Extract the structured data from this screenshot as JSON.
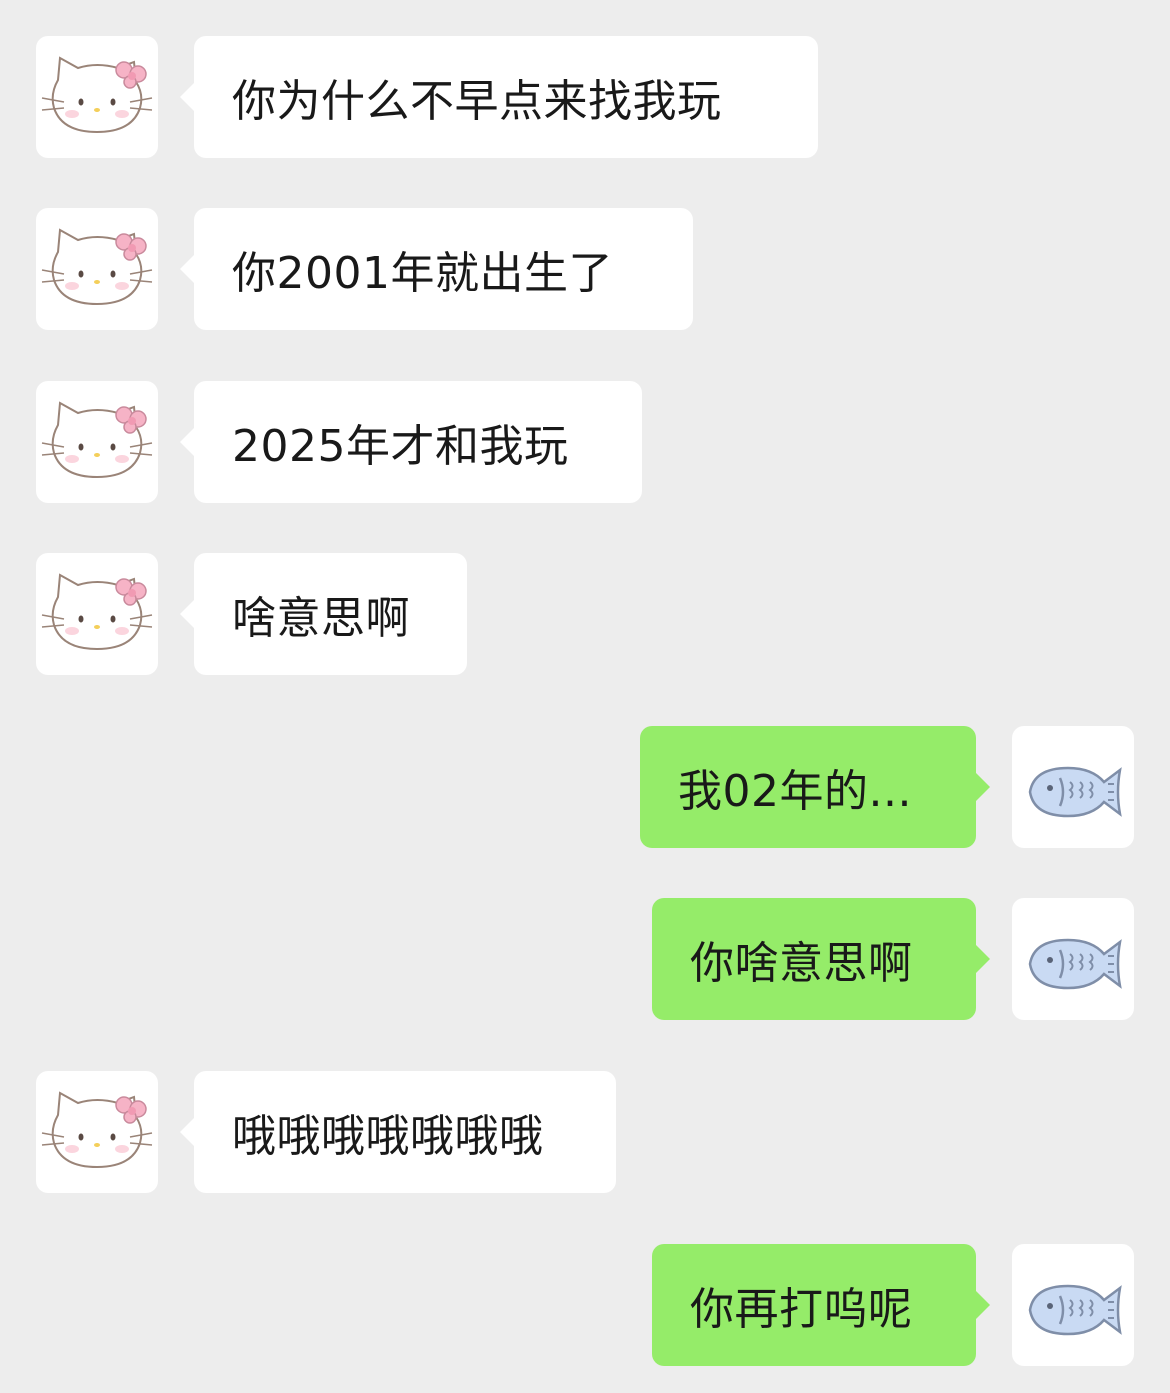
{
  "messages": [
    {
      "side": "in",
      "text": "你为什么不早点来找我玩"
    },
    {
      "side": "in",
      "text": "你2001年就出生了"
    },
    {
      "side": "in",
      "text": "2025年才和我玩"
    },
    {
      "side": "in",
      "text": "啥意思啊"
    },
    {
      "side": "out",
      "text": "我02年的..."
    },
    {
      "side": "out",
      "text": "你啥意思啊"
    },
    {
      "side": "in",
      "text": "哦哦哦哦哦哦哦"
    },
    {
      "side": "out",
      "text": "你再打呜呢"
    }
  ],
  "avatars": {
    "contact": "hello-kitty-icon",
    "self": "fish-icon"
  },
  "colors": {
    "background": "#ededed",
    "incoming_bubble": "#ffffff",
    "outgoing_bubble": "#95ec69",
    "text": "#191919"
  }
}
